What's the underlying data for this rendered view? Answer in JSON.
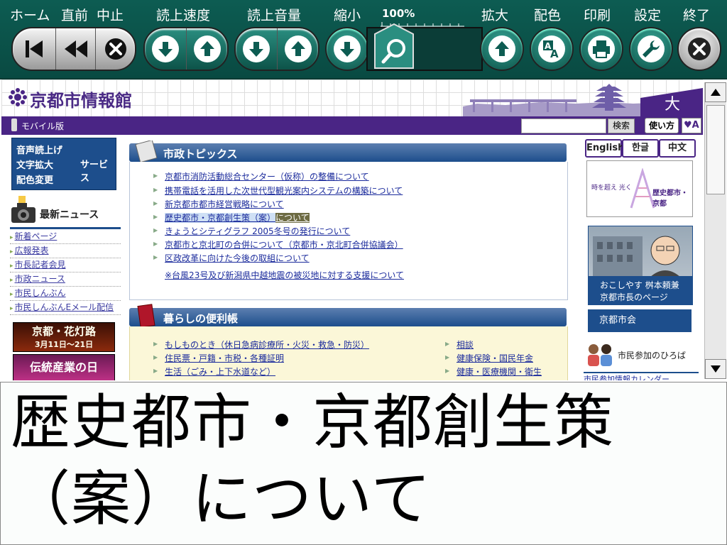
{
  "toolbar": {
    "labels": {
      "home": "ホーム",
      "prev": "直前",
      "stop": "中止",
      "speed": "読上速度",
      "volume": "読上音量",
      "shrink": "縮小",
      "zoom": "100%",
      "enlarge": "拡大",
      "color": "配色",
      "print": "印刷",
      "settings": "設定",
      "exit": "終了"
    },
    "icons": [
      "skip-to-start-icon",
      "rewind-icon",
      "stop-icon",
      "arrow-down-icon",
      "arrow-up-icon",
      "magnifier-icon",
      "font-color-icon",
      "printer-icon",
      "wrench-icon",
      "close-icon"
    ]
  },
  "site": {
    "logo": "京都市情報館",
    "mobile_link": "モバイル版",
    "search": {
      "value": "",
      "button": "検索"
    },
    "usage_button": "使い方",
    "color_button": "♥A",
    "service_box": {
      "rows": [
        "音声読上げ",
        "文字拡大",
        "配色変更"
      ],
      "label": "サービス"
    },
    "news": {
      "title": "最新ニュース",
      "items": [
        "新着ページ",
        "広報発表",
        "市長記者会見",
        "市政ニュース",
        "市民しんぶん",
        "市民しんぶんEメール配信"
      ]
    },
    "banners": {
      "hanatouro": {
        "title": "京都・花灯路",
        "date": "3月11日〜21日"
      },
      "dento": "伝統産業の日"
    },
    "topics": {
      "title": "市政トピックス",
      "items": [
        "京都市消防活動総合センター（仮称）の整備について",
        "携帯電話を活用した次世代型観光案内システムの構築について",
        "新京都市都市経営戦略について",
        "きょうとシティグラフ 2005冬号の発行について",
        "京都市と京北町の合併について（京都市・京北町合併協議会）",
        "区政改革に向けた今後の取組について",
        "※台風23号及び新潟県中越地震の被災地に対する支援について"
      ],
      "highlighted": {
        "part1": "歴史都市・京都創生策（案）",
        "part2": "について"
      }
    },
    "living": {
      "title": "暮らしの便利帳",
      "left": [
        "もしものとき（休日急病診療所・火災・救急・防災）",
        "住民票・戸籍・市税・各種証明",
        "生活（ごみ・上下水道など）"
      ],
      "right": [
        "相談",
        "健康保険・国民年金",
        "健康・医療機関・衛生"
      ]
    },
    "languages": [
      "English",
      "한글",
      "中文"
    ],
    "kyoto_banner": {
      "left": "時を超え 光く",
      "right": "歴史都市・京都"
    },
    "mayor": {
      "line1": "おこしやす 桝本頼兼",
      "line2": "京都市長のページ"
    },
    "council": "京都市会",
    "citizen": {
      "title": "市民参加のひろば",
      "link": "市民参加情報カレンダー"
    }
  },
  "reading": {
    "text": "歴史都市・京都創生策（案）について"
  },
  "colors": {
    "toolbar": "#0d5c52",
    "purple": "#4a2585",
    "navy": "#1d4e8c"
  }
}
